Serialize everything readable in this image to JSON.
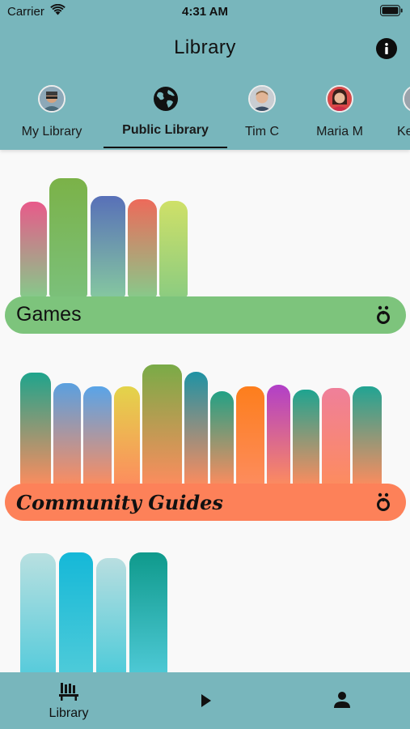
{
  "status_bar": {
    "carrier": "Carrier",
    "time": "4:31 AM"
  },
  "header": {
    "title": "Library",
    "info_icon": "info-icon"
  },
  "tabs": [
    {
      "label": "My Library",
      "icon": "avatar"
    },
    {
      "label": "Public Library",
      "icon": "globe-icon",
      "active": true
    },
    {
      "label": "Tim C",
      "icon": "avatar"
    },
    {
      "label": "Maria M",
      "icon": "avatar"
    },
    {
      "label": "Ke",
      "icon": "avatar"
    }
  ],
  "shelves": [
    {
      "title": "Games",
      "bar_color": "#7dc47c",
      "icon": "hive-icon"
    },
    {
      "title": "Community Guides",
      "bar_color": "#fd8159",
      "icon": "hive-icon"
    },
    {
      "title": "",
      "bar_color": "#4ec9d6"
    }
  ],
  "bottom_nav": [
    {
      "label": "Library",
      "icon": "library-icon"
    },
    {
      "label": "",
      "icon": "play-icon"
    },
    {
      "label": "",
      "icon": "person-icon"
    }
  ],
  "colors": {
    "header_bg": "#78b6bc",
    "page_bg": "#f9f9f9",
    "games_bar": "#7dc47c",
    "guides_bar": "#fd8159"
  }
}
